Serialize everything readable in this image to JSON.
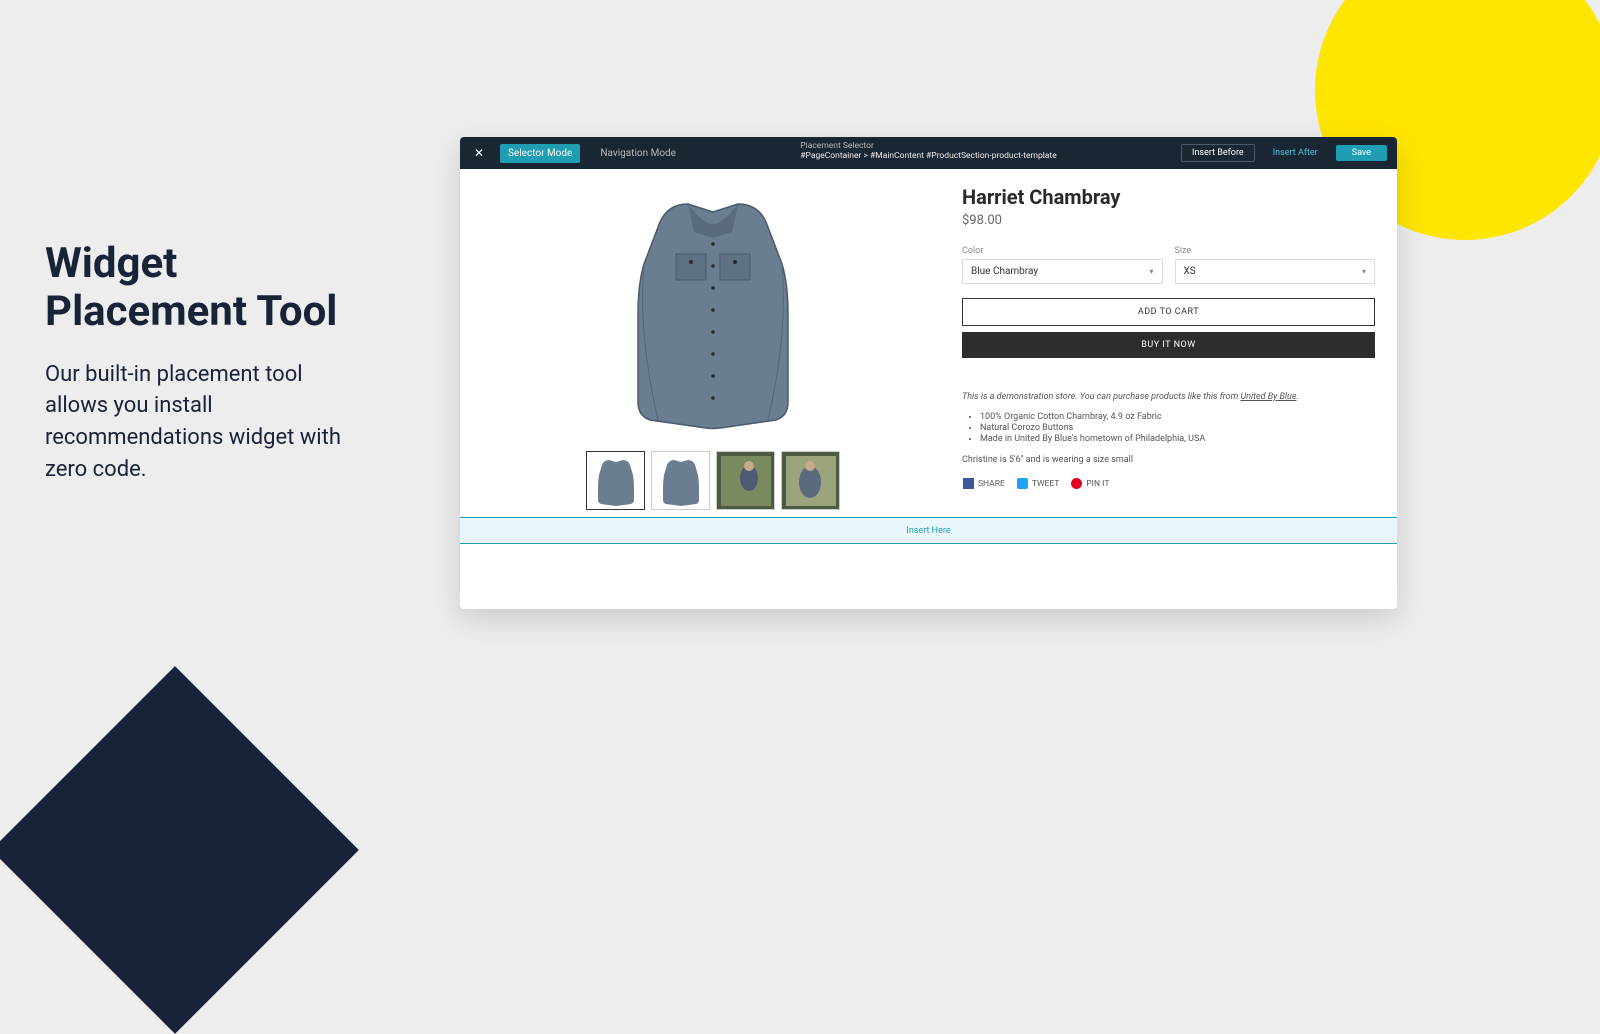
{
  "copy": {
    "title": "Widget Placement Tool",
    "desc": "Our built-in placement tool allows you install recommendations widget with zero code."
  },
  "toolbar": {
    "selector_mode": "Selector Mode",
    "navigation_mode": "Navigation Mode",
    "header_label": "Placement Selector",
    "selector_path": "#PageContainer > #MainContent #ProductSection-product-template",
    "insert_before": "Insert Before",
    "insert_after": "Insert After",
    "save": "Save"
  },
  "product": {
    "title": "Harriet Chambray",
    "price": "$98.00",
    "color_label": "Color",
    "color_value": "Blue Chambray",
    "size_label": "Size",
    "size_value": "XS",
    "add_to_cart": "ADD TO CART",
    "buy_now": "BUY IT NOW",
    "demo_prefix": "This is a demonstration store. You can purchase products like this from ",
    "demo_link": "United By Blue",
    "demo_suffix": ".",
    "features": [
      "100% Organic Cotton Chambray, 4.9 oz Fabric",
      "Natural Corozo Buttons",
      "Made in United By Blue's hometown of Philadelphia, USA"
    ],
    "model_note": "Christine is 5'6\" and is wearing a size small",
    "share": "SHARE",
    "tweet": "TWEET",
    "pin": "PIN IT"
  },
  "insert_here": "Insert Here"
}
